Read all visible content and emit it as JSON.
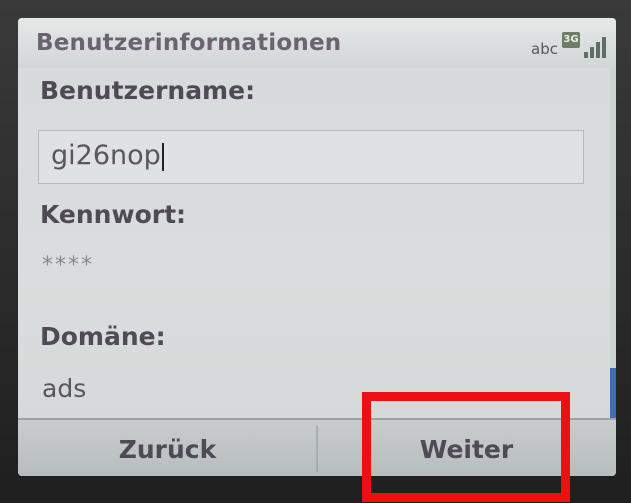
{
  "window": {
    "title": "Benutzerinformationen"
  },
  "status_bar": {
    "input_mode": "abc",
    "network_badge": "3G",
    "signal_icon": "signal-strength-icon"
  },
  "form": {
    "username": {
      "label": "Benutzername:",
      "value": "gi26nop"
    },
    "password": {
      "label": "Kennwort:",
      "value": "****"
    },
    "domain": {
      "label": "Domäne:",
      "value": "ads"
    }
  },
  "softkeys": {
    "left": "Zurück",
    "right": "Weiter"
  },
  "colors": {
    "highlight": "#ee0f12",
    "scroll_thumb": "#3d6fb4"
  }
}
